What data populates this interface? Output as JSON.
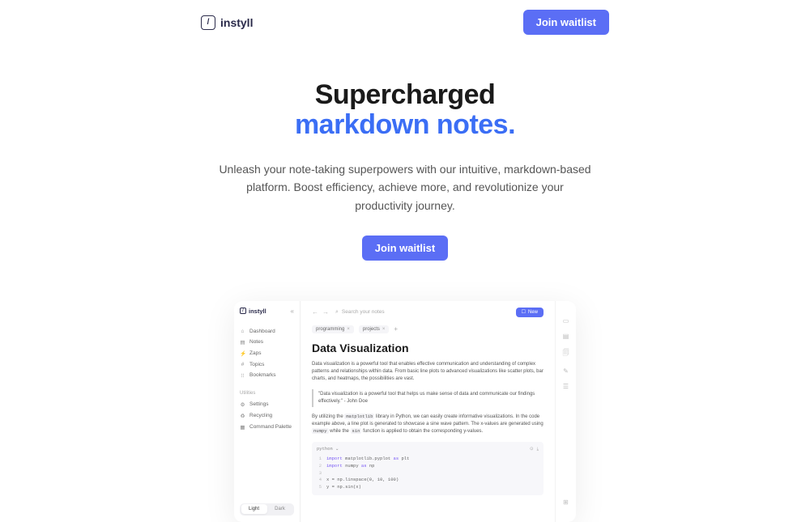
{
  "header": {
    "brand": "instyll",
    "logo_glyph": "/",
    "cta": "Join waitlist"
  },
  "hero": {
    "title_line1": "Supercharged",
    "title_line2": "markdown notes.",
    "subtitle": "Unleash your note-taking superpowers with our intuitive, markdown-based platform. Boost efficiency, achieve more, and revolutionize your productivity journey.",
    "cta": "Join waitlist"
  },
  "preview": {
    "brand": "instyll",
    "logo_glyph": "/",
    "collapse_glyph": "«",
    "nav": [
      {
        "icon": "⌂",
        "label": "Dashboard"
      },
      {
        "icon": "▤",
        "label": "Notes"
      },
      {
        "icon": "⚡",
        "label": "Zaps"
      },
      {
        "icon": "#",
        "label": "Topics"
      },
      {
        "icon": "⁝⁝",
        "label": "Bookmarks"
      }
    ],
    "utilities_label": "Utilities",
    "utilities": [
      {
        "icon": "⚙",
        "label": "Settings"
      },
      {
        "icon": "♻",
        "label": "Recycling"
      },
      {
        "icon": "▦",
        "label": "Command Palette"
      }
    ],
    "theme": {
      "light": "Light",
      "dark": "Dark"
    },
    "topbar": {
      "back": "←",
      "forward": "→",
      "search_icon": "⌕",
      "search_placeholder": "Search your notes",
      "new_icon": "☐",
      "new_label": "New"
    },
    "tags": [
      {
        "label": "programming",
        "close": "×"
      },
      {
        "label": "projects",
        "close": "×"
      }
    ],
    "tag_add": "+",
    "doc": {
      "title": "Data Visualization",
      "para1": "Data visualization is a powerful tool that enables effective communication and understanding of complex patterns and relationships within data. From basic line plots to advanced visualizations like scatter plots, bar charts, and heatmaps, the possibilities are vast.",
      "quote": "\"Data visualization is a powerful tool that helps us make sense of data and communicate our findings effectively.\" - John Doe",
      "para2_a": "By utilizing the ",
      "para2_code1": "matplotlib",
      "para2_b": " library in Python, we can easily create informative visualizations. In the code example above, a line plot is generated to showcase a sine wave pattern. The x-values are generated using ",
      "para2_code2": "numpy",
      "para2_c": " while the ",
      "para2_code3": "sin",
      "para2_d": " function is applied to obtain the corresponding y-values."
    },
    "code": {
      "language": "python",
      "chevron": "⌄",
      "action_copy": "⊙",
      "action_download": "⤓",
      "lines": [
        {
          "n": "1",
          "a": "import",
          "b": " matplotlib.pyplot ",
          "c": "as",
          "d": " plt"
        },
        {
          "n": "2",
          "a": "import",
          "b": " numpy ",
          "c": "as",
          "d": " np"
        },
        {
          "n": "3",
          "a": "",
          "b": "",
          "c": "",
          "d": ""
        },
        {
          "n": "4",
          "a": "",
          "b": "x = np.linspace(0, 10, 100)",
          "c": "",
          "d": ""
        },
        {
          "n": "5",
          "a": "",
          "b": "y = np.sin(x)",
          "c": "",
          "d": ""
        }
      ]
    },
    "rail": {
      "i1": "▭",
      "i2": "▤",
      "i3": "🗐",
      "i4": "✎",
      "i5": "☰",
      "i6": "⊞"
    }
  }
}
